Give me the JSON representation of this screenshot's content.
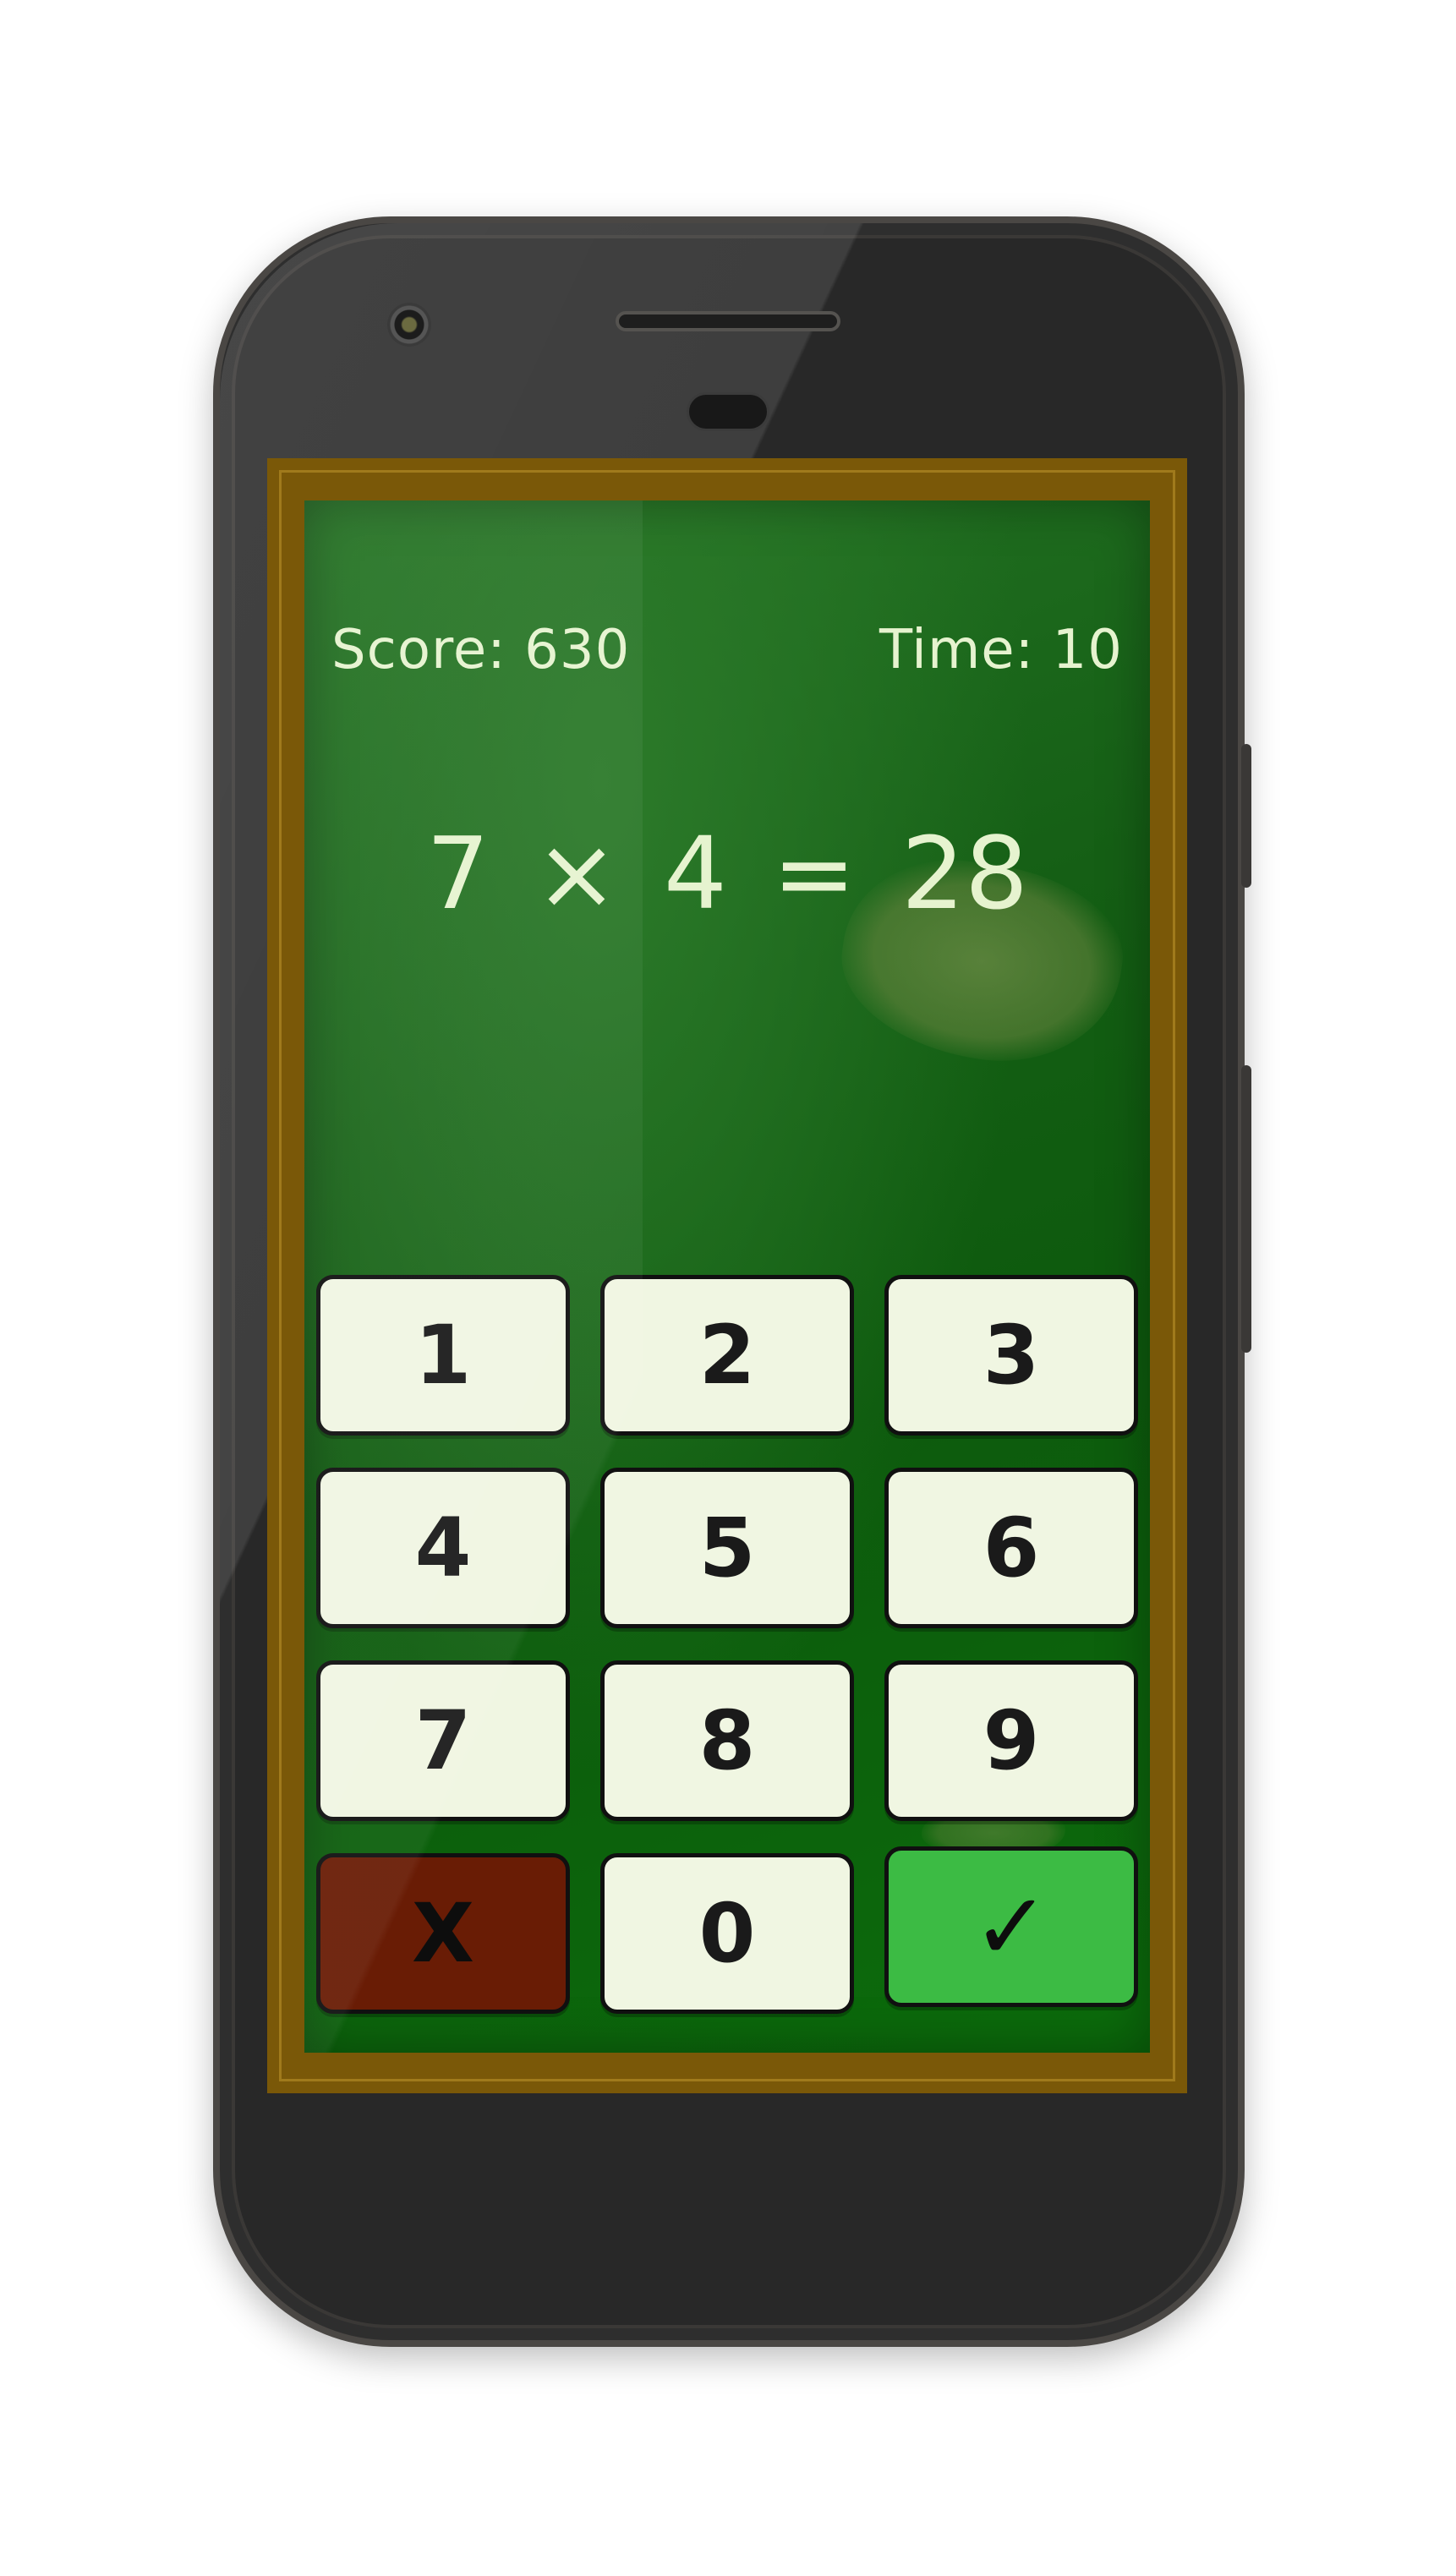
{
  "game": {
    "score_label": "Score: 630",
    "time_label": "Time: 10",
    "equation": {
      "left_operand": "7",
      "operator": "×",
      "right_operand": "4",
      "equals": "=",
      "answer": "28"
    }
  },
  "keypad": {
    "keys": [
      "1",
      "2",
      "3",
      "4",
      "5",
      "6",
      "7",
      "8",
      "9"
    ],
    "clear_label": "X",
    "zero_label": "0",
    "submit_label": "✓"
  },
  "colors": {
    "board_green": "#0d5a0d",
    "frame_brown": "#7a5808",
    "chalk_text": "#e6f3cf",
    "key_bg": "#f0f6e2",
    "clear_bg": "#691c05",
    "submit_bg": "#3cbb44"
  }
}
